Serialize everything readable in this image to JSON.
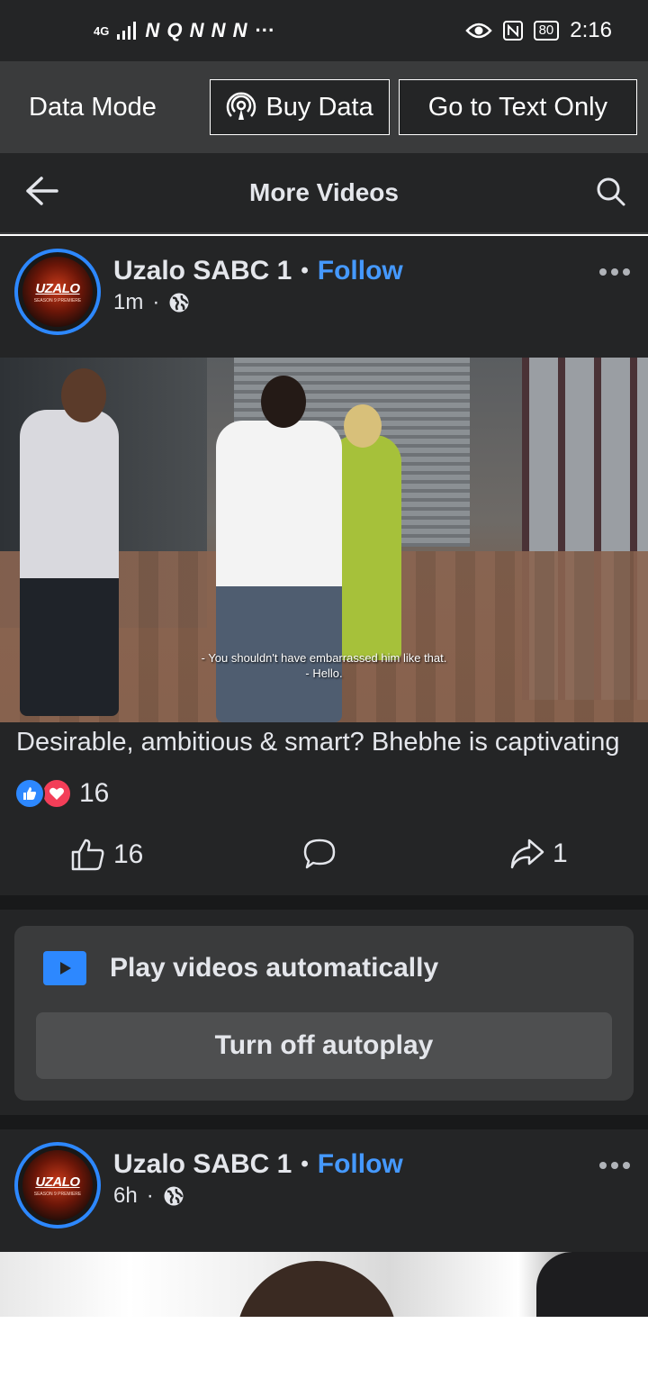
{
  "status_bar": {
    "network": "4G",
    "notif_icons": "N Q N N N",
    "overflow": "···",
    "battery": "80",
    "time": "2:16"
  },
  "data_bar": {
    "mode_label": "Data Mode",
    "buy_data_label": "Buy Data",
    "text_only_label": "Go to Text Only"
  },
  "header": {
    "title": "More Videos"
  },
  "posts": [
    {
      "page_name": "Uzalo SABC 1",
      "separator": "•",
      "follow_label": "Follow",
      "time": "1m",
      "meta_dot": "·",
      "avatar_logo": "UZALO",
      "avatar_sub": "SEASON 9 PREMIERE",
      "subtitle_line_1": "- You shouldn't have embarrassed him like that.",
      "subtitle_line_2": "- Hello.",
      "caption": "Desirable, ambitious & smart? Bhebhe  is captivating",
      "reaction_count": "16",
      "like_count": "16",
      "share_count": "1"
    },
    {
      "page_name": "Uzalo SABC 1",
      "separator": "•",
      "follow_label": "Follow",
      "time": "6h",
      "meta_dot": "·",
      "avatar_logo": "UZALO",
      "avatar_sub": "SEASON 9 PREMIERE"
    }
  ],
  "autoplay": {
    "title": "Play videos automatically",
    "button_label": "Turn off autoplay"
  },
  "colors": {
    "background": "#242526",
    "accent": "#2d88ff",
    "follow": "#4599ff",
    "love": "#f33e58"
  }
}
